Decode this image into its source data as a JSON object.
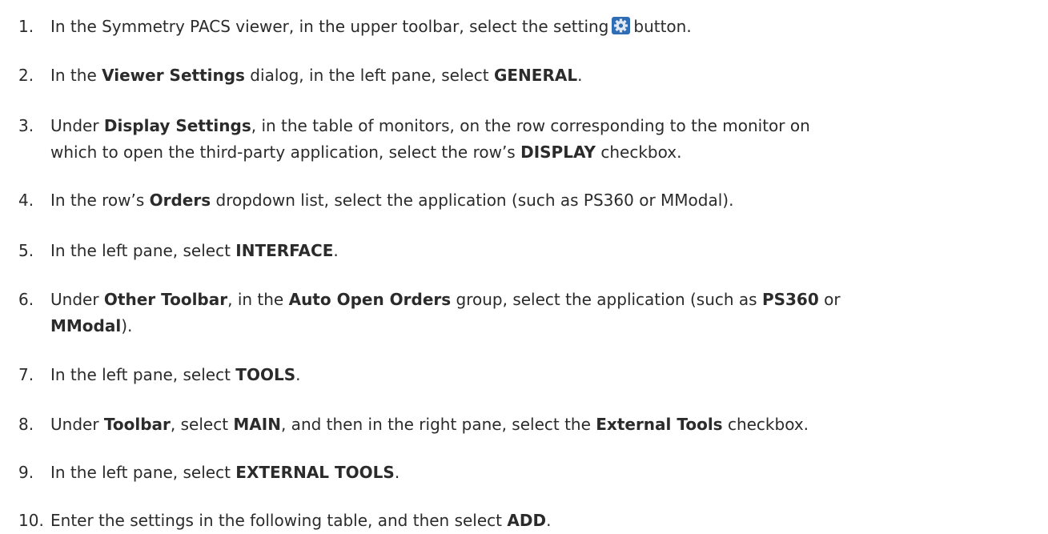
{
  "steps": [
    {
      "number": "1.",
      "parts": [
        {
          "t": "In the Symmetry PACS viewer, in the upper toolbar, select the setting"
        },
        {
          "icon": "settings-gear-icon"
        },
        {
          "t": "button."
        }
      ]
    },
    {
      "number": "2.",
      "parts": [
        {
          "t": "In the "
        },
        {
          "b": "Viewer Settings"
        },
        {
          "t": " dialog, in the left pane, select "
        },
        {
          "b": "GENERAL"
        },
        {
          "t": "."
        }
      ]
    },
    {
      "number": "3.",
      "parts": [
        {
          "t": "Under "
        },
        {
          "b": "Display Settings"
        },
        {
          "t": ", in the table of monitors, on the row corresponding to the monitor on"
        }
      ],
      "line2": [
        {
          "t": "which to open the third-party application, select the row’s "
        },
        {
          "b": "DISPLAY"
        },
        {
          "t": " checkbox."
        }
      ]
    },
    {
      "number": "4.",
      "parts": [
        {
          "t": "In the row’s "
        },
        {
          "b": "Orders"
        },
        {
          "t": " dropdown list, select the application (such as PS360 or MModal)."
        }
      ]
    },
    {
      "number": "5.",
      "parts": [
        {
          "t": "In the left pane, select "
        },
        {
          "b": "INTERFACE"
        },
        {
          "t": "."
        }
      ]
    },
    {
      "number": "6.",
      "parts": [
        {
          "t": "Under "
        },
        {
          "b": "Other Toolbar"
        },
        {
          "t": ", in the "
        },
        {
          "b": "Auto Open Orders"
        },
        {
          "t": " group, select the application (such as "
        },
        {
          "b": "PS360"
        },
        {
          "t": " or"
        }
      ],
      "line2": [
        {
          "b": "MModal"
        },
        {
          "t": ")."
        }
      ]
    },
    {
      "number": "7.",
      "parts": [
        {
          "t": "In the left pane, select "
        },
        {
          "b": "TOOLS"
        },
        {
          "t": "."
        }
      ]
    },
    {
      "number": "8.",
      "parts": [
        {
          "t": "Under "
        },
        {
          "b": "Toolbar"
        },
        {
          "t": ", select "
        },
        {
          "b": "MAIN"
        },
        {
          "t": ", and then in the right pane, select the "
        },
        {
          "b": "External Tools"
        },
        {
          "t": " checkbox."
        }
      ]
    },
    {
      "number": "9.",
      "parts": [
        {
          "t": "In the left pane, select "
        },
        {
          "b": "EXTERNAL TOOLS"
        },
        {
          "t": "."
        }
      ]
    },
    {
      "number": "10.",
      "parts": [
        {
          "t": "Enter the settings in the following table, and then select "
        },
        {
          "b": "ADD"
        },
        {
          "t": "."
        }
      ]
    }
  ],
  "colors": {
    "text": "#2b2b2b",
    "gear_icon": "#2f6db5"
  }
}
